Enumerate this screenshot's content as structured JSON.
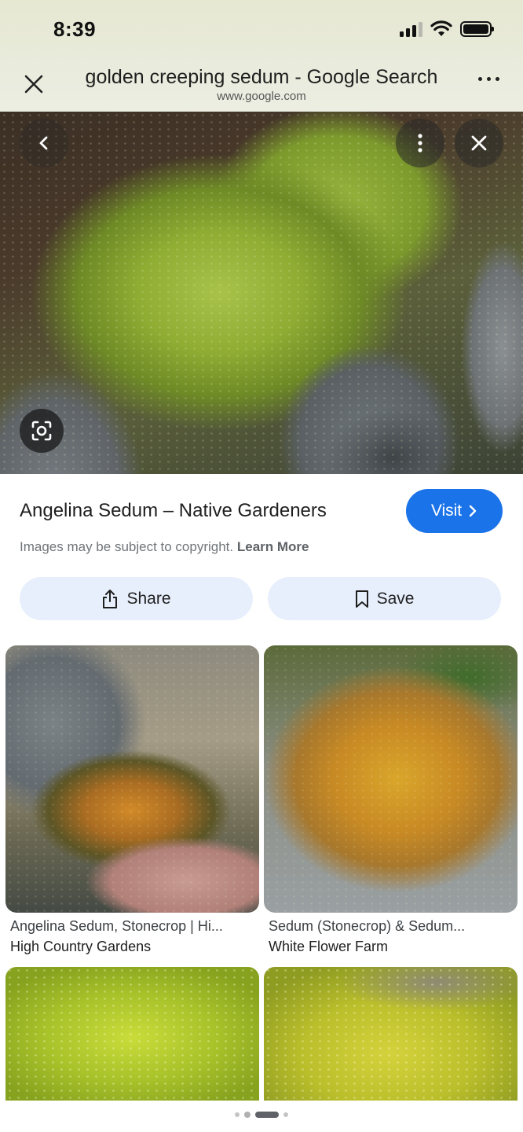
{
  "status_bar": {
    "time": "8:39"
  },
  "browser": {
    "page_title": "golden creeping sedum - Google Search",
    "url": "www.google.com"
  },
  "result": {
    "title": "Angelina Sedum – Native Gardeners",
    "visit_label": "Visit",
    "copyright_text": "Images may be subject to copyright.",
    "learn_more_label": "Learn More",
    "share_label": "Share",
    "save_label": "Save"
  },
  "related": [
    {
      "title": "Angelina Sedum, Stonecrop | Hi...",
      "source": "High Country Gardens"
    },
    {
      "title": "Sedum (Stonecrop) & Sedum...",
      "source": "White Flower Farm"
    },
    {
      "title": "",
      "source": ""
    },
    {
      "title": "",
      "source": ""
    }
  ],
  "colors": {
    "accent": "#1a73e8",
    "action_button_bg": "#e8effc"
  },
  "icons": [
    "close-icon",
    "more-icon",
    "back-chevron-icon",
    "vertical-more-icon",
    "lens-icon",
    "chevron-right-icon",
    "share-icon",
    "bookmark-icon"
  ]
}
